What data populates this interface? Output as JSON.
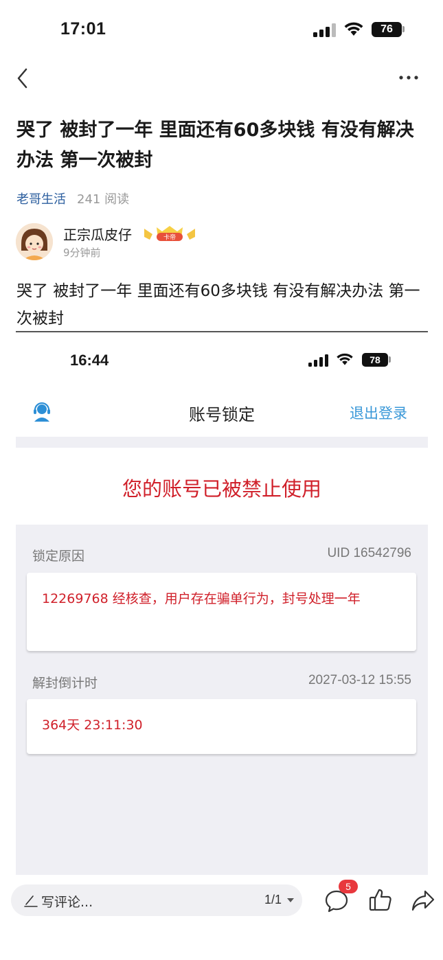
{
  "status_bar": {
    "time": "17:01",
    "battery": "76"
  },
  "post": {
    "title": "哭了 被封了一年 里面还有60多块钱 有没有解决办法 第一次被封",
    "channel": "老哥生活",
    "views": "241 阅读",
    "author": {
      "name": "正宗瓜皮仔",
      "badge": "卡帝",
      "time": "9分钟前"
    },
    "body": "哭了 被封了一年 里面还有60多块钱 有没有解决办法 第一次被封"
  },
  "screenshot": {
    "status_time": "16:44",
    "battery": "78",
    "header_title": "账号锁定",
    "logout_label": "退出登录",
    "banned_message": "您的账号已被禁止使用",
    "reason_label": "锁定原因",
    "uid": "UID 16542796",
    "reason_text": "12269768 经核查，用户存在骗单行为，封号处理一年",
    "countdown_label": "解封倒计时",
    "unlock_date": "2027-03-12 15:55",
    "countdown_value": "364天 23:11:30",
    "accent_red": "#d0202a",
    "accent_blue": "#3a98d8"
  },
  "bottom_bar": {
    "comment_placeholder": "写评论...",
    "page_indicator": "1/1",
    "comment_count": "5"
  },
  "icons": [
    "back-icon",
    "more-icon",
    "support-agent-icon",
    "pencil-icon",
    "comment-icon",
    "like-icon",
    "share-icon"
  ]
}
